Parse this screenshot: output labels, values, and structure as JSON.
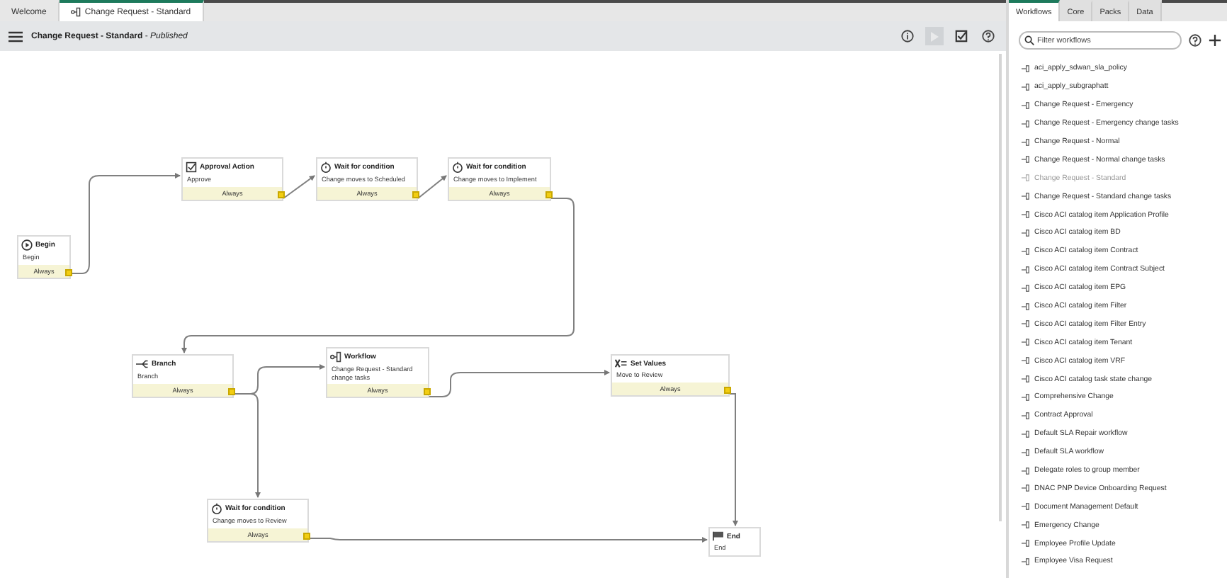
{
  "tabs": [
    {
      "label": "Welcome",
      "selected": false,
      "kind": "plain"
    },
    {
      "label": "Change Request - Standard",
      "selected": true,
      "kind": "workflow"
    }
  ],
  "toolbar": {
    "title": "**Change Request - Standard** - *Published*",
    "run_disabled": true
  },
  "nodes": [
    {
      "kind": "begin",
      "title": "Begin",
      "description": "Begin",
      "condition": "Always"
    },
    {
      "kind": "approval",
      "title": "Approval Action",
      "description": "Approve",
      "condition": "Always"
    },
    {
      "kind": "timer",
      "title": "Wait for condition",
      "description": "Change moves to Scheduled",
      "condition": "Always"
    },
    {
      "kind": "timer",
      "title": "Wait for condition",
      "description": "Change moves to Implement",
      "condition": "Always"
    },
    {
      "kind": "branch",
      "title": "Branch",
      "description": "Branch",
      "condition": "Always"
    },
    {
      "kind": "workflow",
      "title": "Workflow",
      "description": "Change Request - Standard change tasks",
      "condition": "Always"
    },
    {
      "kind": "setvalues",
      "title": "Set Values",
      "description": "Move to Review",
      "condition": "Always"
    },
    {
      "kind": "timer",
      "title": "Wait for condition",
      "description": "Change moves to Review",
      "condition": "Always"
    },
    {
      "kind": "end",
      "title": "End",
      "description": "End"
    }
  ],
  "panel_tabs": [
    {
      "label": "Workflows",
      "selected": true
    },
    {
      "label": "Core",
      "selected": false
    },
    {
      "label": "Packs",
      "selected": false
    },
    {
      "label": "Data",
      "selected": false
    }
  ],
  "search": {
    "placeholder": "Filter workflows"
  },
  "workflows": [
    {
      "name": "aci_apply_sdwan_sla_policy",
      "disabled": false
    },
    {
      "name": "aci_apply_subgraphatt",
      "disabled": false
    },
    {
      "name": "Change Request - Emergency",
      "disabled": false
    },
    {
      "name": "Change Request - Emergency change tasks",
      "disabled": false
    },
    {
      "name": "Change Request - Normal",
      "disabled": false
    },
    {
      "name": "Change Request - Normal change tasks",
      "disabled": false
    },
    {
      "name": "Change Request - Standard",
      "disabled": true
    },
    {
      "name": "Change Request - Standard change tasks",
      "disabled": false
    },
    {
      "name": "Cisco ACI catalog item Application Profile",
      "disabled": false
    },
    {
      "name": "Cisco ACI catalog item BD",
      "disabled": false
    },
    {
      "name": "Cisco ACI catalog item Contract",
      "disabled": false
    },
    {
      "name": "Cisco ACI catalog item Contract Subject",
      "disabled": false
    },
    {
      "name": "Cisco ACI catalog item EPG",
      "disabled": false
    },
    {
      "name": "Cisco ACI catalog item Filter",
      "disabled": false
    },
    {
      "name": "Cisco ACI catalog item Filter Entry",
      "disabled": false
    },
    {
      "name": "Cisco ACI catalog item Tenant",
      "disabled": false
    },
    {
      "name": "Cisco ACI catalog item VRF",
      "disabled": false
    },
    {
      "name": "Cisco ACI catalog task state change",
      "disabled": false
    },
    {
      "name": "Comprehensive Change",
      "disabled": false
    },
    {
      "name": "Contract Approval",
      "disabled": false
    },
    {
      "name": "Default SLA Repair workflow",
      "disabled": false
    },
    {
      "name": "Default SLA workflow",
      "disabled": false
    },
    {
      "name": "Delegate roles to group member",
      "disabled": false
    },
    {
      "name": "DNAC PNP Device Onboarding Request",
      "disabled": false
    },
    {
      "name": "Document Management Default",
      "disabled": false
    },
    {
      "name": "Emergency Change",
      "disabled": false
    },
    {
      "name": "Employee Profile Update",
      "disabled": false
    },
    {
      "name": "Employee Visa Request",
      "disabled": false
    }
  ]
}
